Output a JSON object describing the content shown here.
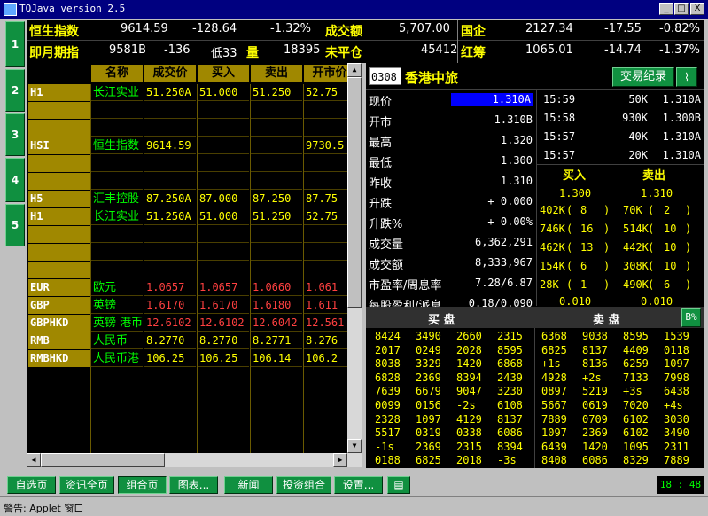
{
  "window": {
    "title": "TQJava version 2.5",
    "min": "_",
    "max": "□",
    "close": "X"
  },
  "left_tabs": [
    "1",
    "2",
    "3",
    "4",
    "5"
  ],
  "index_rows": [
    {
      "name": "恒生指数",
      "value": "9614.59",
      "change": "-128.64",
      "pct": "-1.32%",
      "label": "成交额",
      "amount": "5,707.00",
      "name2": "国企",
      "value2": "2127.34",
      "change2": "-17.55",
      "pct2": "-0.82%"
    },
    {
      "name": "即月期指",
      "value": "9581B",
      "change": "-136",
      "pct": "低33",
      "label": "量",
      "qty": "18395",
      "label2": "未平仓",
      "amount": "45412",
      "name2": "红筹",
      "value2": "1065.01",
      "change2": "-14.74",
      "pct2": "-1.37%"
    }
  ],
  "table": {
    "headers": [
      "名称",
      "成交价",
      "买入",
      "卖出",
      "开市价"
    ],
    "rows": [
      {
        "code": "H1",
        "name": "长江实业",
        "price": "51.250A",
        "buy": "51.000",
        "sell": "51.250",
        "open": "52.75",
        "color": "yellow"
      },
      {
        "code": "",
        "name": "",
        "price": "",
        "buy": "",
        "sell": "",
        "open": "",
        "color": "yellow"
      },
      {
        "code": "",
        "name": "",
        "price": "",
        "buy": "",
        "sell": "",
        "open": "",
        "color": "yellow"
      },
      {
        "code": "HSI",
        "name": "恒生指数",
        "price": "9614.59",
        "buy": "",
        "sell": "",
        "open": "9730.5",
        "color": "yellow"
      },
      {
        "code": "",
        "name": "",
        "price": "",
        "buy": "",
        "sell": "",
        "open": "",
        "color": "yellow"
      },
      {
        "code": "",
        "name": "",
        "price": "",
        "buy": "",
        "sell": "",
        "open": "",
        "color": "yellow"
      },
      {
        "code": "H5",
        "name": "汇丰控股",
        "price": "87.250A",
        "buy": "87.000",
        "sell": "87.250",
        "open": "87.75",
        "color": "yellow"
      },
      {
        "code": "H1",
        "name": "长江实业",
        "price": "51.250A",
        "buy": "51.000",
        "sell": "51.250",
        "open": "52.75",
        "color": "yellow"
      },
      {
        "code": "",
        "name": "",
        "price": "",
        "buy": "",
        "sell": "",
        "open": "",
        "color": "yellow"
      },
      {
        "code": "",
        "name": "",
        "price": "",
        "buy": "",
        "sell": "",
        "open": "",
        "color": "yellow"
      },
      {
        "code": "",
        "name": "",
        "price": "",
        "buy": "",
        "sell": "",
        "open": "",
        "color": "yellow"
      },
      {
        "code": "EUR",
        "name": "欧元",
        "price": "1.0657",
        "buy": "1.0657",
        "sell": "1.0660",
        "open": "1.061",
        "color": "red"
      },
      {
        "code": "GBP",
        "name": "英镑",
        "price": "1.6170",
        "buy": "1.6170",
        "sell": "1.6180",
        "open": "1.611",
        "color": "red"
      },
      {
        "code": "GBPHKD",
        "name": "英镑 港币",
        "price": "12.6102",
        "buy": "12.6102",
        "sell": "12.6042",
        "open": "12.561",
        "color": "red"
      },
      {
        "code": "RMB",
        "name": "人民币",
        "price": "8.2770",
        "buy": "8.2770",
        "sell": "8.2771",
        "open": "8.276",
        "color": "yellow"
      },
      {
        "code": "RMBHKD",
        "name": "人民币港",
        "price": "106.25",
        "buy": "106.25",
        "sell": "106.14",
        "open": "106.2",
        "color": "yellow"
      }
    ]
  },
  "detail": {
    "code": "0308",
    "name": "香港中旅",
    "trade_button": "交易纪录",
    "fields": [
      {
        "label": "现价",
        "value": "1.310A"
      },
      {
        "label": "开市",
        "value": "1.310B"
      },
      {
        "label": "最高",
        "value": "1.320"
      },
      {
        "label": "最低",
        "value": "1.300"
      },
      {
        "label": "昨收",
        "value": "1.310"
      },
      {
        "label": "升跌",
        "value": "+ 0.000"
      },
      {
        "label": "升跌%",
        "value": "+ 0.00%"
      },
      {
        "label": "成交量",
        "value": "6,362,291"
      },
      {
        "label": "成交额",
        "value": "8,333,967"
      },
      {
        "label": "市盈率/周息率",
        "value": "7.28/6.87"
      },
      {
        "label": "每股盈利/派息",
        "value": "0.18/0.090"
      }
    ],
    "ticks": [
      {
        "time": "15:59",
        "vol": "50K",
        "price": "1.310A"
      },
      {
        "time": "15:58",
        "vol": "930K",
        "price": "1.300B"
      },
      {
        "time": "15:57",
        "vol": "40K",
        "price": "1.310A"
      },
      {
        "time": "15:57",
        "vol": "20K",
        "price": "1.310A"
      }
    ],
    "buy_label": "买入",
    "sell_label": "卖出",
    "buy_price": "1.300",
    "sell_price": "1.310",
    "queue": [
      {
        "bvol": "402K",
        "bn": "8",
        "svol": "70K",
        "sn": "2"
      },
      {
        "bvol": "746K",
        "bn": "16",
        "svol": "514K",
        "sn": "10"
      },
      {
        "bvol": "462K",
        "bn": "13",
        "svol": "442K",
        "sn": "10"
      },
      {
        "bvol": "154K",
        "bn": "6",
        "svol": "308K",
        "sn": "10"
      },
      {
        "bvol": "28K",
        "bn": "1",
        "svol": "490K",
        "sn": "6"
      }
    ],
    "spread_buy": "0.010",
    "spread_sell": "0.010",
    "buy_panel": "买  盘",
    "sell_panel": "卖  盘",
    "pct_button": "B%",
    "brokers_buy": [
      [
        "8424",
        "3490",
        "2660",
        "2315"
      ],
      [
        "2017",
        "0249",
        "2028",
        "8595"
      ],
      [
        "8038",
        "3329",
        "1420",
        "6868"
      ],
      [
        "6828",
        "2369",
        "8394",
        "2439"
      ],
      [
        "7639",
        "6679",
        "9047",
        "3230"
      ],
      [
        "0099",
        "0156",
        "-2s",
        "6108"
      ],
      [
        "2328",
        "1097",
        "4129",
        "8137"
      ],
      [
        "5517",
        "0319",
        "0338",
        "6086"
      ],
      [
        "-1s",
        "2369",
        "2315",
        "8394"
      ],
      [
        "0188",
        "6825",
        "2018",
        "-3s"
      ]
    ],
    "brokers_sell": [
      [
        "6368",
        "9038",
        "8595",
        "1539"
      ],
      [
        "6825",
        "8137",
        "4409",
        "0118"
      ],
      [
        "+1s",
        "8136",
        "6259",
        "1097"
      ],
      [
        "4928",
        "+2s",
        "7133",
        "7998"
      ],
      [
        "0897",
        "5219",
        "+3s",
        "6438"
      ],
      [
        "5667",
        "0619",
        "7020",
        "+4s"
      ],
      [
        "7889",
        "0709",
        "6102",
        "3030"
      ],
      [
        "1097",
        "2369",
        "6102",
        "3490"
      ],
      [
        "6439",
        "1420",
        "1095",
        "2311"
      ],
      [
        "8408",
        "6086",
        "8329",
        "7889"
      ]
    ]
  },
  "bottom_buttons": [
    "自选页",
    "资讯全页",
    "组合页",
    "图表...",
    "新闻",
    "投资组合",
    "设置..."
  ],
  "clock": "18 : 48",
  "status": "警告: Applet 窗口"
}
